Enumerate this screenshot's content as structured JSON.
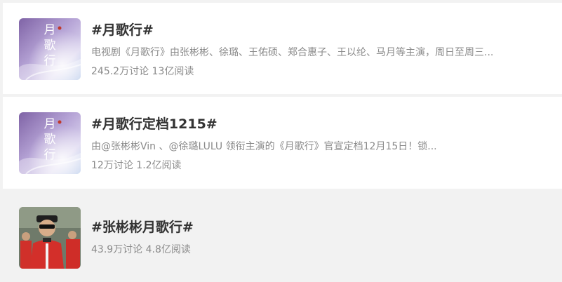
{
  "topics": [
    {
      "title": "#月歌行#",
      "description": "电视剧《月歌行》由张彬彬、徐璐、王佑硕、郑合惠子、王以纶、马月等主演，周日至周三...",
      "discussions": "245.2万讨论",
      "reads": "13亿阅读",
      "cover_text": "月歌行",
      "cover_icon": "poster-image"
    },
    {
      "title": "#月歌行定档1215#",
      "description": "由@张彬彬Vin 、@徐璐LULU 领衔主演的《月歌行》官宣定档12月15日！锁...",
      "discussions": "12万讨论",
      "reads": "1.2亿阅读",
      "cover_text": "月歌行",
      "cover_icon": "poster-image"
    },
    {
      "title": "#张彬彬月歌行#",
      "description": "",
      "discussions": "43.9万讨论",
      "reads": "4.8亿阅读",
      "cover_icon": "photo-image"
    }
  ],
  "colors": {
    "title": "#333333",
    "meta": "#8a8a8a",
    "hover_bg": "#f2f2f2",
    "card_bg": "#ffffff"
  }
}
